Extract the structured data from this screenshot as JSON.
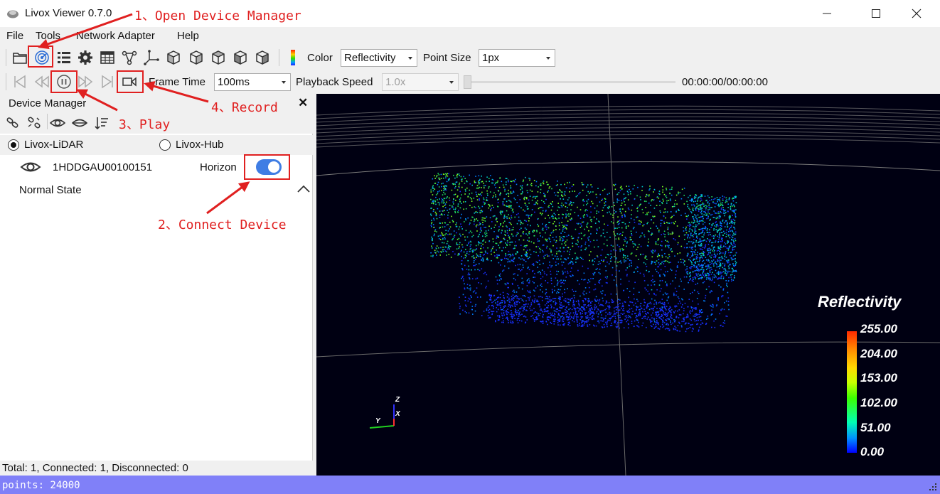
{
  "window": {
    "title": "Livox Viewer 0.7.0"
  },
  "menu": [
    "File",
    "Tools",
    "Network Adapter",
    "Help"
  ],
  "toolbar": {
    "color_label": "Color",
    "color_value": "Reflectivity",
    "point_size_label": "Point Size",
    "point_size_value": "1px"
  },
  "playback": {
    "frame_time_label": "Frame Time",
    "frame_time_value": "100ms",
    "speed_label": "Playback Speed",
    "speed_value": "1.0x",
    "time": "00:00:00/00:00:00"
  },
  "device_manager": {
    "title": "Device Manager",
    "close": "✕",
    "radio_lidar": "Livox-LiDAR",
    "radio_hub": "Livox-Hub",
    "device_sn": "1HDDGAU00100151",
    "device_type": "Horizon",
    "device_status": "Normal State",
    "footer": "Total: 1, Connected: 1, Disconnected: 0"
  },
  "viewport": {
    "legend_title": "Reflectivity",
    "legend_values": [
      "255.00",
      "204.00",
      "153.00",
      "102.00",
      "51.00",
      "0.00"
    ],
    "axis_labels": {
      "z": "Z",
      "x": "X",
      "y": "Y"
    }
  },
  "statusbar": {
    "text": "points: 24000"
  },
  "annotations": {
    "open_device_manager": "1、Open Device Manager",
    "connect_device": "2、Connect Device",
    "play": "3、Play",
    "record": "4、Record"
  },
  "colors": {
    "accent": "#3f7de4",
    "annotation": "#e02020",
    "statusbar": "#8080f8",
    "viewport_bg": "#000012"
  }
}
